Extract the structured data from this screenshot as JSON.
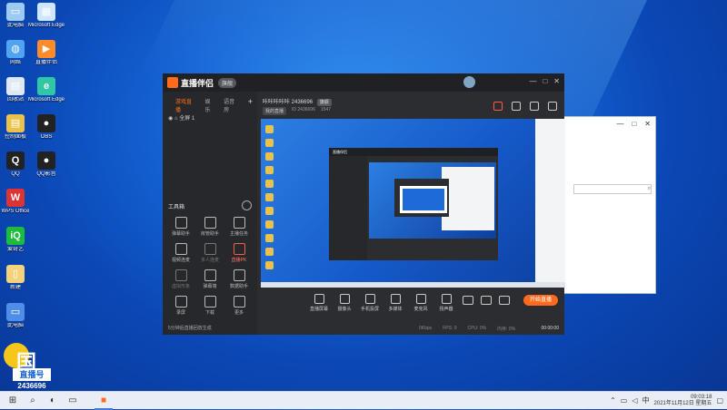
{
  "desktop": {
    "icons": [
      {
        "label": "此电脑",
        "glyph": "▭",
        "color": "#9ccaf5"
      },
      {
        "label": "Microsoft Edge",
        "glyph": "▦",
        "color": "#cfe6ff"
      },
      {
        "label": "网络",
        "glyph": "◍",
        "color": "#4fa3f0"
      },
      {
        "label": "直播伴侣",
        "glyph": "▶",
        "color": "#ff8a2a"
      },
      {
        "label": "回收站",
        "glyph": "▤",
        "color": "#dfe9f5"
      },
      {
        "label": "Microsoft Edge",
        "glyph": "e",
        "color": "#2fc7a6"
      },
      {
        "label": "控制面板",
        "glyph": "▤",
        "color": "#e8c24a"
      },
      {
        "label": "OBS",
        "glyph": "●",
        "color": "#222"
      },
      {
        "label": "QQ",
        "glyph": "Q",
        "color": "#222"
      },
      {
        "label": "QQ影音",
        "glyph": "●",
        "color": "#222"
      },
      {
        "label": "WPS Office",
        "glyph": "W",
        "color": "#d33"
      },
      {
        "label": "爱奇艺",
        "glyph": "iQ",
        "color": "#1dbd3c"
      },
      {
        "label": "新建",
        "glyph": "▯",
        "color": "#f2d27a"
      },
      {
        "label": "此电脑",
        "glyph": "▭",
        "color": "#4f8ee6"
      }
    ],
    "big_logo": {
      "line1": "国",
      "line2": "直播号",
      "line3": "2436696"
    }
  },
  "taskbar": {
    "start_icon": "windows-logo",
    "clock_time": "09:03:18",
    "clock_date": "2021年11月12日 星期五"
  },
  "side_window": {
    "min": "—",
    "max": "□",
    "close": "✕",
    "search": "⌕"
  },
  "app": {
    "title": "直播伴侣",
    "version": "旗舰",
    "window_buttons": {
      "min": "—",
      "max": "□",
      "close": "✕"
    },
    "sidebar": {
      "tabs": [
        "游戏直播",
        "娱乐",
        "语音房"
      ],
      "add": "+",
      "scene": "全屏 1",
      "tools_title": "工具箱",
      "tools": [
        {
          "label": "弹幕助手",
          "state": "normal"
        },
        {
          "label": "房管助手",
          "state": "normal"
        },
        {
          "label": "主播任务",
          "state": "normal"
        },
        {
          "label": "视频连麦",
          "state": "normal"
        },
        {
          "label": "多人连麦",
          "state": "dim"
        },
        {
          "label": "直播PK",
          "state": "red"
        },
        {
          "label": "虚拟形象",
          "state": "dim"
        },
        {
          "label": "弹幕墙",
          "state": "normal"
        },
        {
          "label": "数据助手",
          "state": "normal"
        },
        {
          "label": "录屏",
          "state": "normal"
        },
        {
          "label": "下载",
          "state": "normal"
        },
        {
          "label": "更多",
          "state": "normal"
        }
      ],
      "footer": "5分钟后直播回放生成"
    },
    "header": {
      "room_name": "咔咔咔咔咔 2436696",
      "room_tag": "旗舰",
      "sub_chip": "我的直播",
      "sub_id": "ID 2436696",
      "sub_hot": "1547"
    },
    "controls": [
      "直播屏幕",
      "摄像头",
      "手机投屏",
      "多媒体",
      "麦克风",
      "扬声器"
    ],
    "start_live": "开始直播",
    "status": {
      "bitrate": "0Kbps",
      "fps": "FPS: 0",
      "cpu": "CPU: 0%",
      "mem": "内存: 0%",
      "time": "00:00:00"
    }
  }
}
